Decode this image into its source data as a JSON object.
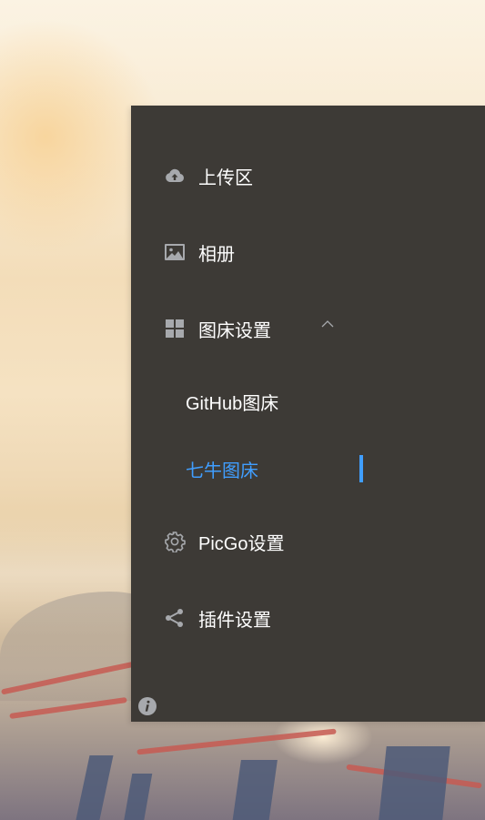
{
  "sidebar": {
    "items": [
      {
        "label": "上传区",
        "icon": "cloud-upload-icon"
      },
      {
        "label": "相册",
        "icon": "image-icon"
      },
      {
        "label": "图床设置",
        "icon": "grid-icon",
        "expanded": true
      },
      {
        "label": "PicGo设置",
        "icon": "gear-icon"
      },
      {
        "label": "插件设置",
        "icon": "share-icon"
      }
    ],
    "submenu": [
      {
        "label": "GitHub图床",
        "active": false
      },
      {
        "label": "七牛图床",
        "active": true
      }
    ],
    "footer_icon": "info-icon"
  },
  "colors": {
    "sidebar_bg": "#3d3a36",
    "text": "#ffffff",
    "icon": "#a7a9ad",
    "accent": "#409eff"
  }
}
